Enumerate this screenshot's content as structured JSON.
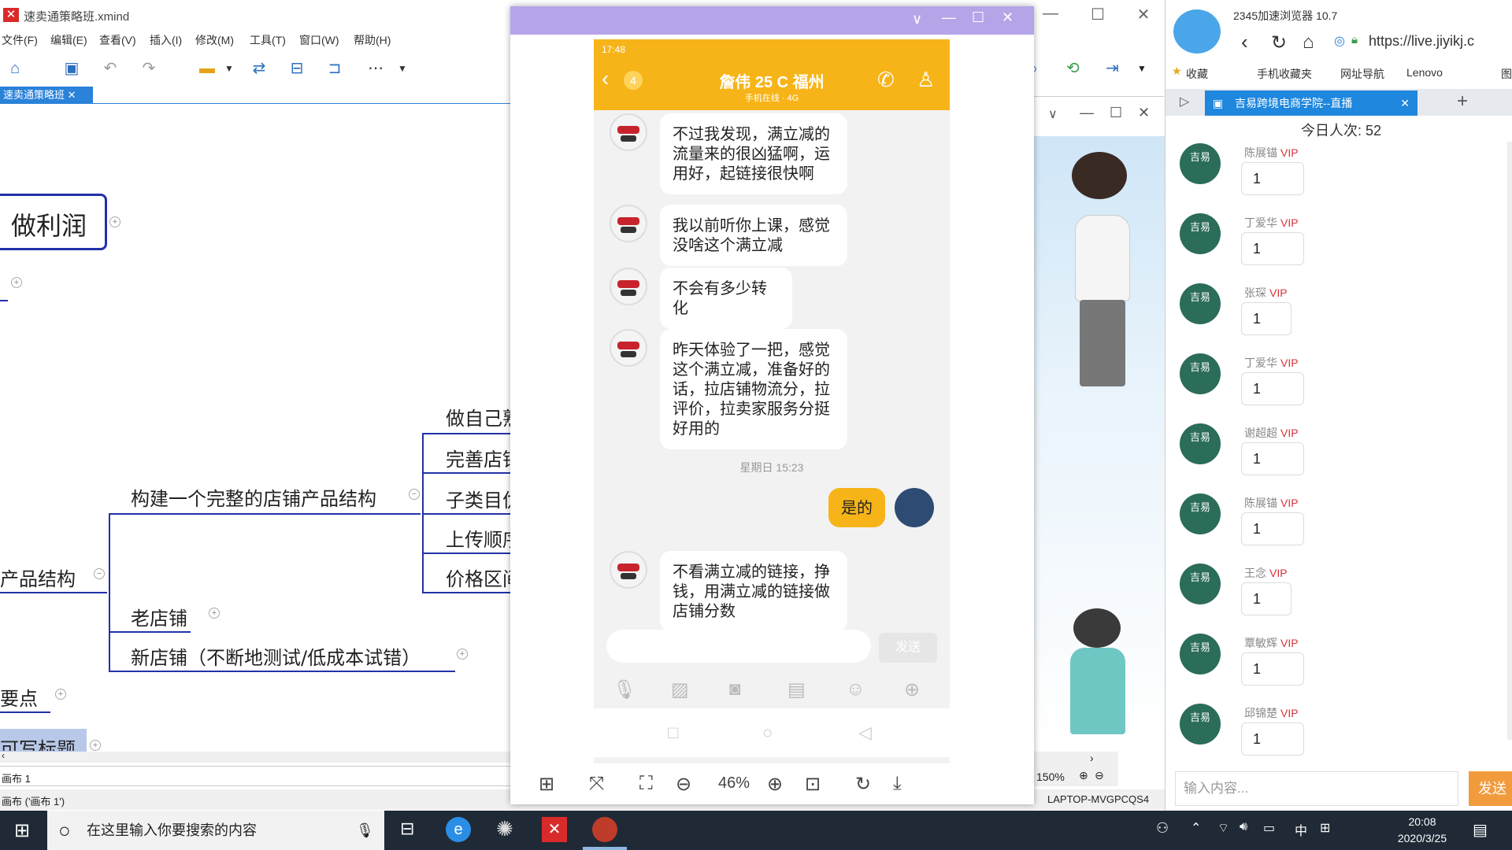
{
  "xmind": {
    "title": "速卖通策略班.xmind",
    "menu": [
      "文件(F)",
      "编辑(E)",
      "查看(V)",
      "插入(I)",
      "修改(M)",
      "工具(T)",
      "窗口(W)",
      "帮助(H)"
    ],
    "tab": "速卖通策略班",
    "nodes": {
      "profit": "做利润",
      "build_structure": "构建一个完整的店铺产品结构",
      "product_structure": "产品结构",
      "old_store": "老店铺",
      "new_store": "新店铺（不断地测试/低成本试错）",
      "key_points": "要点",
      "title_partial": "可写标题",
      "sub1": "做自己熟",
      "sub2": "完善店铺",
      "sub3": "子类目优",
      "sub4": "上传顺序",
      "sub5": "价格区间"
    },
    "sheet": "画布 1",
    "status": "画布 ('画布 1')",
    "zoom": "150%",
    "computer": "LAPTOP-MVGPCQS4"
  },
  "viewer": {
    "phone_status_time": "17:48",
    "contact_name": "詹伟 25 C 福州",
    "contact_sub": "手机在线 · 4G",
    "unread": "4",
    "messages": [
      {
        "text": "不过我发现，满立减的流量来的很凶猛啊，运用好，起链接很快啊"
      },
      {
        "text": "我以前听你上课，感觉没啥这个满立减"
      },
      {
        "text": "不会有多少转化"
      },
      {
        "text": "昨天体验了一把，感觉这个满立减，准备好的话，拉店铺物流分，拉评价，拉卖家服务分挺好用的"
      },
      {
        "text": "不看满立减的链接，挣钱，用满立减的链接做店铺分数"
      }
    ],
    "time_divider": "星期日 15:23",
    "my_message": "是的",
    "send_label": "发送",
    "zoom": "46%"
  },
  "browser": {
    "app_name": "2345加速浏览器 10.7",
    "url": "https://live.jiyikj.c",
    "bookmarks": [
      "收藏",
      "手机收藏夹",
      "网址导航",
      "Lenovo",
      "图"
    ],
    "tab_title": "吉易跨境电商学院--直播",
    "today_count_label": "今日人次: 52",
    "avatar_text": "吉易",
    "vip": "VIP",
    "chat": [
      {
        "name": "陈展锚",
        "msg": "1"
      },
      {
        "name": "丁爱华",
        "msg": "1"
      },
      {
        "name": "张琛",
        "msg": "1"
      },
      {
        "name": "丁爱华",
        "msg": "1"
      },
      {
        "name": "谢超超",
        "msg": "1"
      },
      {
        "name": "陈展锚",
        "msg": "1"
      },
      {
        "name": "王念",
        "msg": "1"
      },
      {
        "name": "覃敏辉",
        "msg": "1"
      },
      {
        "name": "邱锦楚",
        "msg": "1"
      }
    ],
    "input_placeholder": "输入内容...",
    "send_label": "发送"
  },
  "taskbar": {
    "search_placeholder": "在这里输入你要搜索的内容",
    "time": "20:08",
    "date": "2020/3/25",
    "ime": "中"
  }
}
